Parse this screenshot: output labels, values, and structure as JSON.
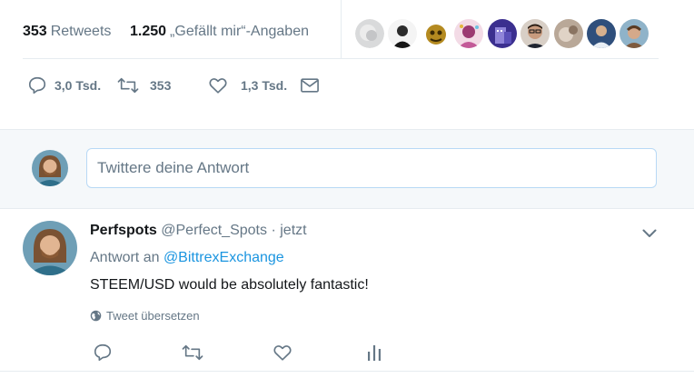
{
  "stats": {
    "retweets_count": "353",
    "retweets_label": "Retweets",
    "likes_count": "1.250",
    "likes_label": "„Gefällt mir“-Angaben"
  },
  "liker_avatars": [
    "avatar-1",
    "avatar-2",
    "avatar-3",
    "avatar-4",
    "avatar-5",
    "avatar-6",
    "avatar-7",
    "avatar-8",
    "avatar-9"
  ],
  "actions": {
    "reply_count": "3,0 Tsd.",
    "retweet_count": "353",
    "like_count": "1,3 Tsd."
  },
  "reply_box": {
    "placeholder": "Twittere deine Antwort"
  },
  "reply_tweet": {
    "name": "Perfspots",
    "handle": "@Perfect_Spots",
    "separator": "·",
    "time": "jetzt",
    "replying_to_label": "Antwort an",
    "replying_to_handle": "@BittrexExchange",
    "text": "STEEM/USD would be absolutely fantastic!",
    "translate_label": "Tweet übersetzen"
  },
  "colors": {
    "accent": "#1b95e0",
    "muted": "#657786",
    "reply_bg": "#f5f8fa"
  }
}
